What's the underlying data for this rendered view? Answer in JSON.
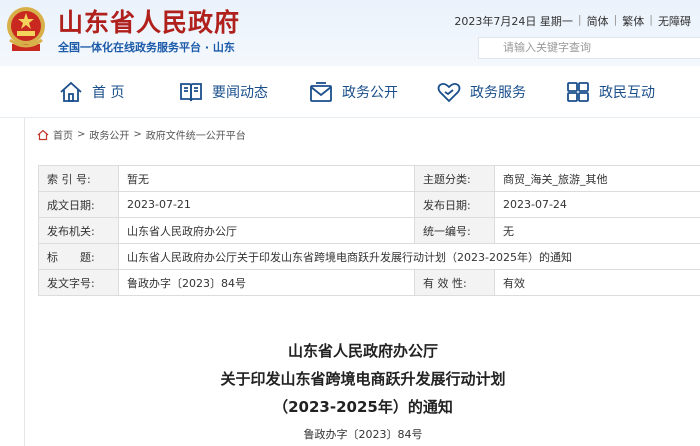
{
  "header": {
    "site_title": "山东省人民政府",
    "site_subtitle": "全国一体化在线政务服务平台 · 山东",
    "date": "2023年7月24日 星期一",
    "links": [
      "简体",
      "繁体",
      "无障碍"
    ],
    "search_placeholder": "请输入关键字查询"
  },
  "nav": {
    "items": [
      {
        "label": "首 页",
        "icon": "home-icon"
      },
      {
        "label": "要闻动态",
        "icon": "book-icon"
      },
      {
        "label": "政务公开",
        "icon": "mail-icon"
      },
      {
        "label": "政务服务",
        "icon": "heart-hand-icon"
      },
      {
        "label": "政民互动",
        "icon": "people-icon"
      }
    ]
  },
  "breadcrumb": [
    "首页",
    "政务公开",
    "政府文件统一公开平台"
  ],
  "info_table": {
    "index_label": "索 引 号:",
    "index_value": "暂无",
    "category_label": "主题分类:",
    "category_value": "商贸_海关_旅游_其他",
    "created_label": "成文日期:",
    "created_value": "2023-07-21",
    "published_label": "发布日期:",
    "published_value": "2023-07-24",
    "issuer_label": "发布机关:",
    "issuer_value": "山东省人民政府办公厅",
    "unified_no_label": "统一编号:",
    "unified_no_value": "无",
    "title_label": "标　　题:",
    "title_value": "山东省人民政府办公厅关于印发山东省跨境电商跃升发展行动计划（2023-2025年）的通知",
    "doc_no_label": "发文字号:",
    "doc_no_value": "鲁政办字〔2023〕84号",
    "validity_label": "有 效 性:",
    "validity_value": "有效"
  },
  "article": {
    "title_line1": "山东省人民政府办公厅",
    "title_line2": "关于印发山东省跨境电商跃升发展行动计划",
    "title_line3": "（2023-2025年）的通知",
    "doc_no": "鲁政办字〔2023〕84号"
  },
  "colors": {
    "brand_red": "#b0201c",
    "nav_blue": "#1a4f8c",
    "valid_red": "#d9302a"
  }
}
